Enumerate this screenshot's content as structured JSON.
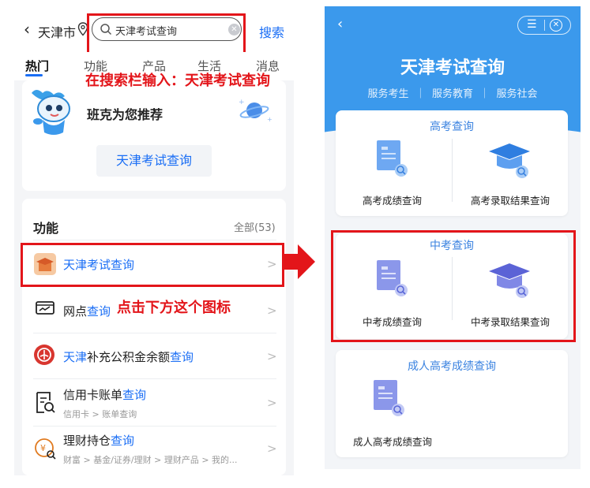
{
  "left": {
    "city": "天津市",
    "search_value": "天津考试查询",
    "search_button": "搜索",
    "tabs": [
      "热门",
      "功能",
      "产品",
      "生活",
      "消息"
    ],
    "annotation_search": "在搜索栏输入：天津考试查询",
    "recommend_text": "班克为您推荐",
    "recommend_button": "天津考试查询",
    "function_title": "功能",
    "function_all": "全部(53)",
    "annotation_icon": "点击下方这个图标",
    "rows": [
      {
        "pre": "",
        "hl": "天津考试查询",
        "post": "",
        "icon": "exam-cap-icon"
      },
      {
        "pre": "网点",
        "hl": "查询",
        "post": "",
        "icon": "branch-icon"
      },
      {
        "pre": "",
        "hl": "天津",
        "post": "补充公积金余额",
        "hl2": "查询",
        "icon": "fund-icon"
      },
      {
        "pre": "信用卡账单",
        "hl": "查询",
        "post": "",
        "sub": "信用卡 > 账单查询",
        "icon": "bill-search-icon"
      },
      {
        "pre": "理财持仓",
        "hl": "查询",
        "post": "",
        "sub": "财富 > 基金/证券/理财 > 理财产品 > 我的...",
        "icon": "wealth-icon"
      }
    ],
    "chevron": ">"
  },
  "right": {
    "title": "天津考试查询",
    "subtitle": "服务考生  ｜  服务教育  ｜  服务社会",
    "menu_glyph": "☰",
    "close_glyph": "✕",
    "gaokao": {
      "title": "高考查询",
      "item1": "高考成绩查询",
      "item2": "高考录取结果查询"
    },
    "zhongkao": {
      "title": "中考查询",
      "item1": "中考成绩查询",
      "item2": "中考录取结果查询"
    },
    "adult": {
      "title": "成人高考成绩查询",
      "item1": "成人高考成绩查询"
    }
  },
  "colors": {
    "accent_blue": "#1a6ef5",
    "header_blue": "#3b99ec",
    "annotation_red": "#e3151a"
  }
}
